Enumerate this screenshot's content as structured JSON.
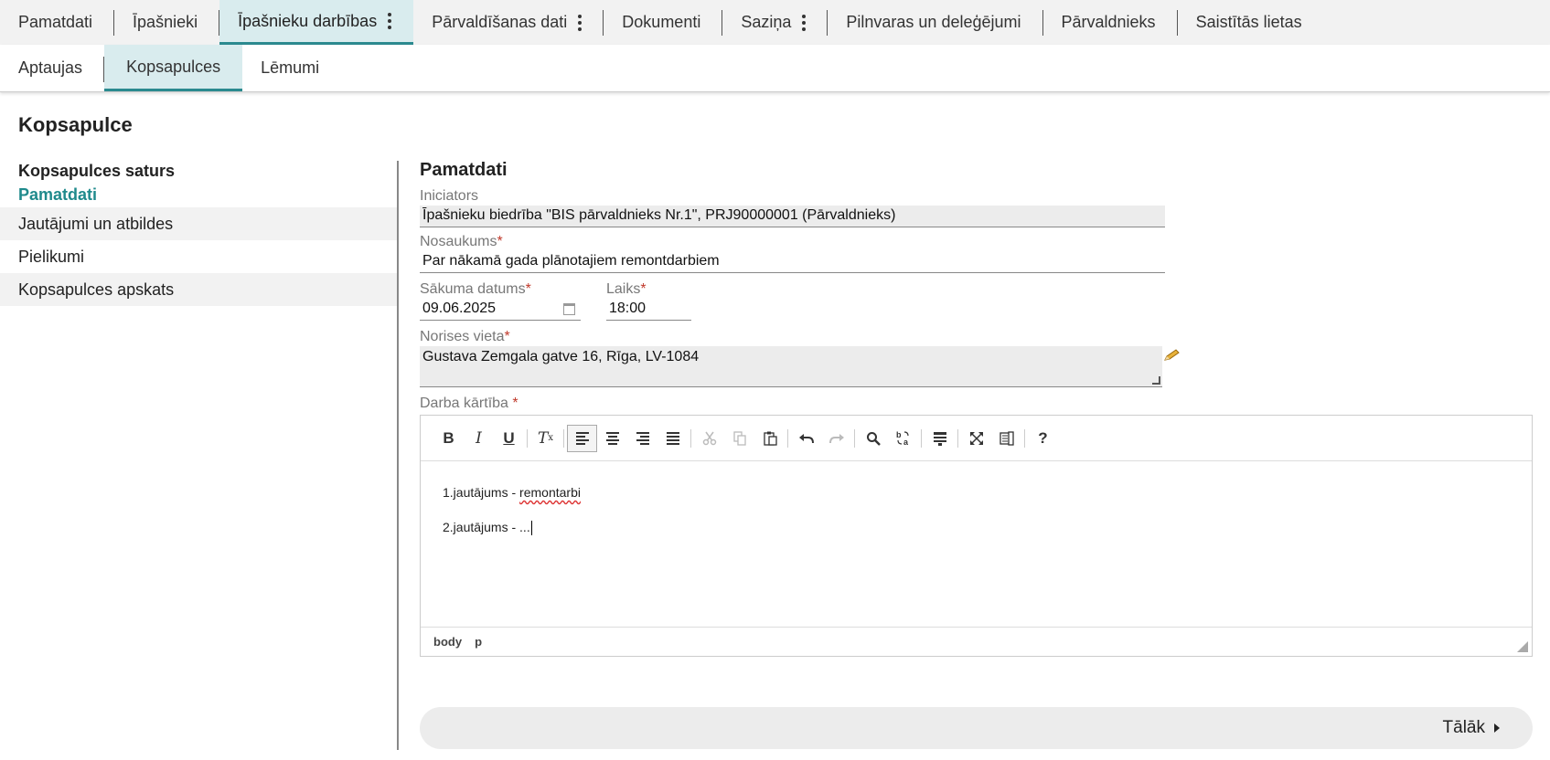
{
  "top_tabs": [
    {
      "label": "Pamatdati"
    },
    {
      "label": "Īpašnieki"
    },
    {
      "label": "Īpašnieku darbības"
    },
    {
      "label": "Pārvaldīšanas dati"
    },
    {
      "label": "Dokumenti"
    },
    {
      "label": "Saziņa"
    },
    {
      "label": "Pilnvaras un deleģējumi"
    },
    {
      "label": "Pārvaldnieks"
    },
    {
      "label": "Saistītās lietas"
    }
  ],
  "sub_tabs": [
    {
      "label": "Aptaujas"
    },
    {
      "label": "Kopsapulces"
    },
    {
      "label": "Lēmumi"
    }
  ],
  "page_title": "Kopsapulce",
  "sidebar": {
    "heading": "Kopsapulces saturs",
    "items": [
      {
        "label": "Pamatdati"
      },
      {
        "label": "Jautājumi un atbildes"
      },
      {
        "label": "Pielikumi"
      },
      {
        "label": "Kopsapulces apskats"
      }
    ]
  },
  "form": {
    "section_title": "Pamatdati",
    "initiator": {
      "label": "Iniciators",
      "value": "Īpašnieku biedrība \"BIS pārvaldnieks Nr.1\", PRJ90000001 (Pārvaldnieks)"
    },
    "title": {
      "label": "Nosaukums",
      "value": "Par nākamā gada plānotajiem remontdarbiem"
    },
    "start_date": {
      "label": "Sākuma datums",
      "value": "09.06.2025"
    },
    "time": {
      "label": "Laiks",
      "value": "18:00"
    },
    "location": {
      "label": "Norises vieta",
      "value": "Gustava Zemgala gatve 16, Rīga, LV-1084"
    },
    "agenda": {
      "label": "Darba kārtība",
      "line1_prefix": "1.jautājums - ",
      "line1_word": "remontarbi",
      "line2": "2.jautājums - ...",
      "path": [
        "body",
        "p"
      ]
    },
    "required_mark": "*"
  },
  "toolbar": {
    "bold": "B",
    "italic": "I",
    "underline": "U",
    "clear": "T",
    "help": "?"
  },
  "next_label": "Tālāk"
}
